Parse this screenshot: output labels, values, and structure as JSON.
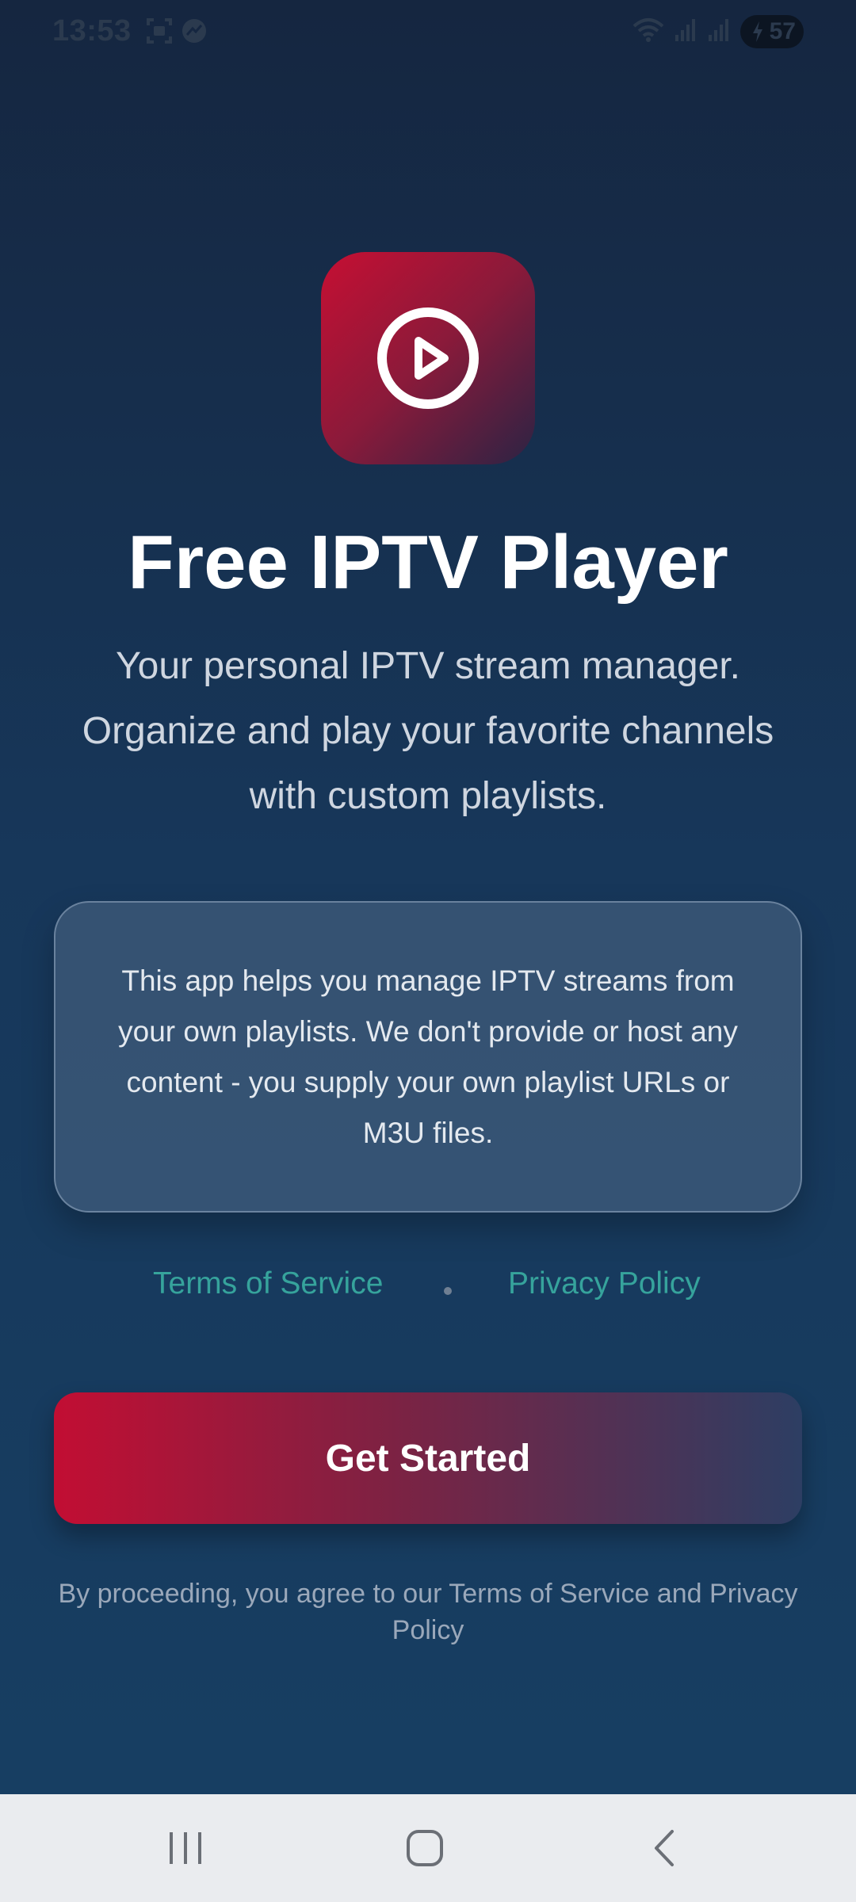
{
  "status_bar": {
    "time": "13:53",
    "battery_level": "57",
    "icons": [
      "screenshot-icon",
      "app-notification-icon",
      "wifi-icon",
      "signal-icon",
      "signal-icon-2",
      "battery-charging-icon"
    ]
  },
  "app": {
    "logo_icon": "play-circle-icon",
    "title": "Free IPTV Player",
    "subtitle": "Your personal IPTV stream manager. Organize and play your favorite channels with custom playlists."
  },
  "info_card": {
    "text": "This app helps you manage IPTV streams from your own playlists. We don't provide or host any content - you supply your own playlist URLs or M3U files."
  },
  "links": {
    "terms": "Terms of Service",
    "privacy": "Privacy Policy"
  },
  "cta": {
    "label": "Get Started"
  },
  "consent": {
    "text": "By proceeding, you agree to our Terms of Service and Privacy Policy"
  },
  "nav_bar": {
    "icons": [
      "recents-icon",
      "home-icon",
      "back-icon"
    ]
  },
  "colors": {
    "background_top": "#152640",
    "background_bottom": "#173f63",
    "accent_red": "#c20e33",
    "link_teal": "#36a39c",
    "nav_bar": "#eaecef"
  }
}
